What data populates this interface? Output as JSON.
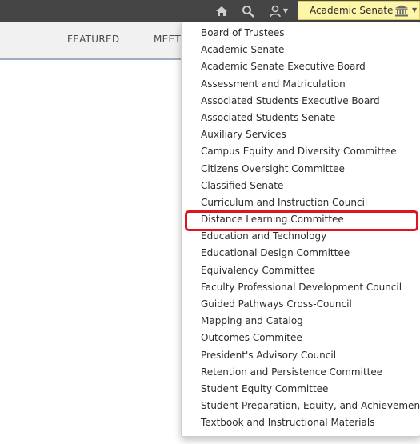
{
  "topbar": {
    "icons": [
      "home-icon",
      "search-icon",
      "user-icon"
    ],
    "selected_group": "Academic Senate",
    "selected_group_icon": "building-icon"
  },
  "nav": {
    "items": [
      "FEATURED",
      "MEET"
    ]
  },
  "dropdown": {
    "items": [
      "Board of Trustees",
      "Academic Senate",
      "Academic Senate Executive Board",
      "Assessment and Matriculation",
      "Associated Students Executive Board",
      "Associated Students Senate",
      "Auxiliary Services",
      "Campus Equity and Diversity Committee",
      "Citizens Oversight Committee",
      "Classified Senate",
      "Curriculum and Instruction Council",
      "Distance Learning Committee",
      "Education and Technology",
      "Educational Design Committee",
      "Equivalency Committee",
      "Faculty Professional Development Council",
      "Guided Pathways Cross-Council",
      "Mapping and Catalog",
      "Outcomes Commitee",
      "President's Advisory Council",
      "Retention and Persistence Committee",
      "Student Equity Committee",
      "Student Preparation, Equity, and Achievement",
      "Textbook and Instructional Materials"
    ],
    "highlighted_item": "Distance Learning Committee",
    "highlight_color": "#e0141e"
  }
}
